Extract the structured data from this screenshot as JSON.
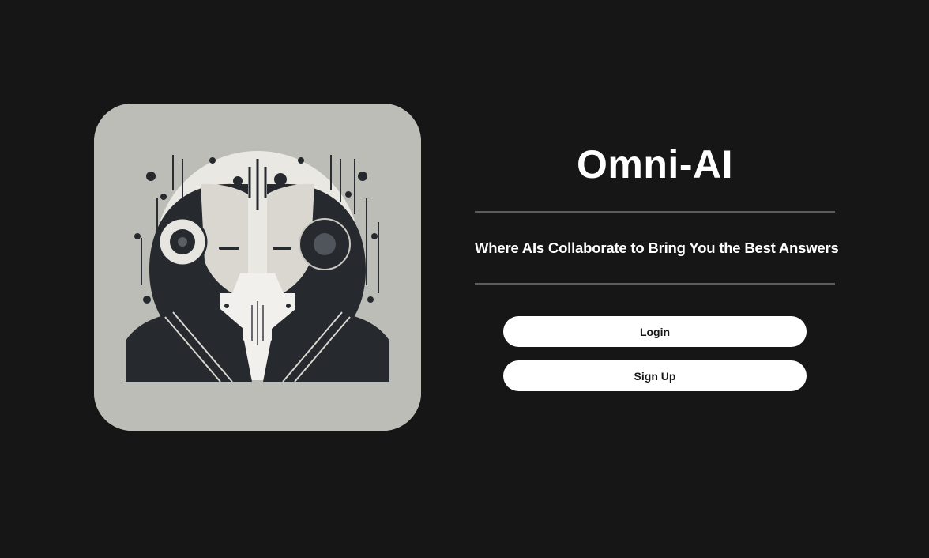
{
  "app": {
    "title": "Omni-AI",
    "tagline": "Where AIs Collaborate to Bring You the Best Answers"
  },
  "logo": {
    "icon": "two-ai-faces-logo-icon",
    "background": "#bdbdb8"
  },
  "actions": {
    "login_label": "Login",
    "signup_label": "Sign Up"
  },
  "colors": {
    "page_background": "#161616",
    "text": "#ffffff",
    "button_background": "#ffffff",
    "button_text": "#161616",
    "divider": "#5c5c5c"
  }
}
